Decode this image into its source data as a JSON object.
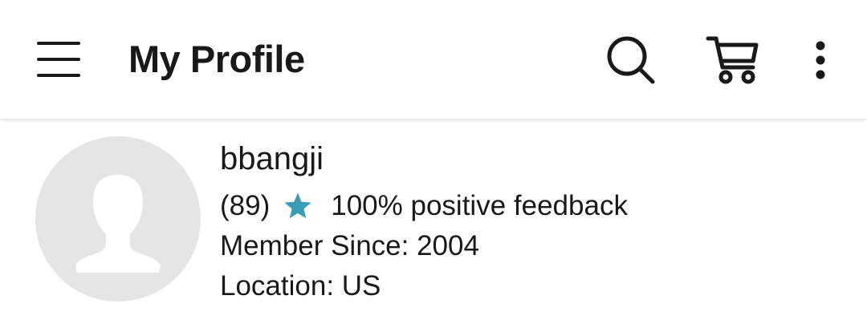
{
  "header": {
    "title": "My Profile",
    "icons": {
      "menu": "hamburger-menu-icon",
      "search": "search-icon",
      "cart": "cart-icon",
      "more": "more-vertical-icon"
    }
  },
  "profile": {
    "username": "bbangji",
    "feedback_score": "(89)",
    "feedback_text": "100% positive feedback",
    "member_since": "Member Since: 2004",
    "location": "Location: US",
    "star_icon": "star-icon"
  },
  "colors": {
    "text": "#191919",
    "star": "#3a9cb5",
    "avatar_bg": "#e5e5e5",
    "avatar_silhouette": "#ffffff"
  }
}
